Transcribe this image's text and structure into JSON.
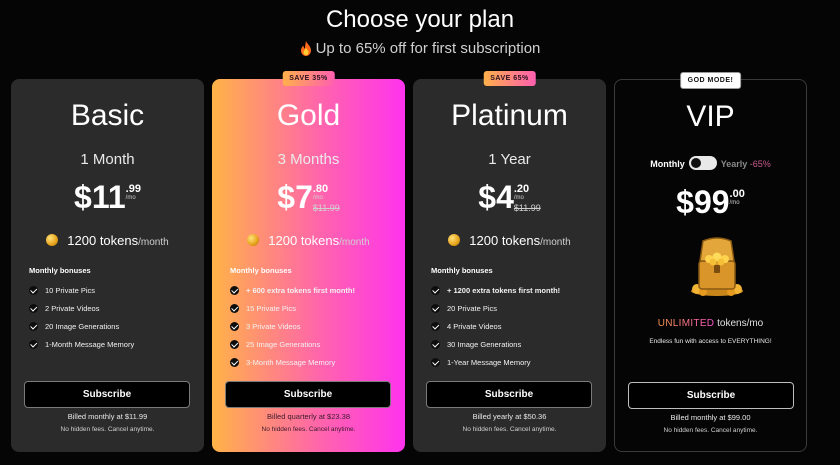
{
  "header": {
    "title": "Choose your plan",
    "subtitle": "Up to 65% off for first subscription"
  },
  "plans": {
    "basic": {
      "name": "Basic",
      "period": "1 Month",
      "price_main": "$11",
      "price_cents": ".99",
      "price_unit": "/mo",
      "tokens": "1200 tokens",
      "tokens_per": "/month",
      "bonus_title": "Monthly bonuses",
      "bonuses": [
        "10 Private Pics",
        "2 Private Videos",
        "20 Image Generations",
        "1-Month Message Memory"
      ],
      "subscribe_label": "Subscribe",
      "billed": "Billed monthly at $11.99",
      "no_fees": "No hidden fees. Cancel anytime."
    },
    "gold": {
      "badge": "SAVE 35%",
      "name": "Gold",
      "period": "3 Months",
      "price_main": "$7",
      "price_cents": ".80",
      "price_unit": "/mo",
      "old_price": "$11.99",
      "tokens": "1200 tokens",
      "tokens_per": "/month",
      "bonus_title": "Monthly bonuses",
      "bonuses": [
        "+ 600 extra tokens first month!",
        "15 Private Pics",
        "3 Private Videos",
        "25 Image Generations",
        "3-Month Message Memory"
      ],
      "subscribe_label": "Subscribe",
      "billed": "Billed quarterly at $23.38",
      "no_fees": "No hidden fees. Cancel anytime."
    },
    "platinum": {
      "badge": "SAVE 65%",
      "name": "Platinum",
      "period": "1 Year",
      "price_main": "$4",
      "price_cents": ".20",
      "price_unit": "/mo",
      "old_price": "$11.99",
      "tokens": "1200 tokens",
      "tokens_per": "/month",
      "bonus_title": "Monthly bonuses",
      "bonuses": [
        "+ 1200 extra tokens first month!",
        "20 Private Pics",
        "4 Private Videos",
        "30 Image Generations",
        "1-Year Message Memory"
      ],
      "subscribe_label": "Subscribe",
      "billed": "Billed yearly at $50.36",
      "no_fees": "No hidden fees. Cancel anytime."
    },
    "vip": {
      "badge": "GOD MODE!",
      "name": "VIP",
      "toggle_monthly": "Monthly",
      "toggle_yearly": "Yearly",
      "toggle_discount": "-65%",
      "price_main": "$99",
      "price_cents": ".00",
      "price_unit": "/mo",
      "unlimited": "UNLIMITED",
      "unlimited_rest": "tokens/mo",
      "endless": "Endless fun with access to EVERYTHING!",
      "subscribe_label": "Subscribe",
      "billed": "Billed monthly at $99.00",
      "no_fees": "No hidden fees. Cancel anytime."
    }
  },
  "colors": {
    "background": "#050505",
    "card": "#2b2b2b",
    "gold_gradient_start": "#ffb347",
    "gold_gradient_end": "#ff33ee",
    "accent_pink": "#ff55c8"
  },
  "icons": {
    "subtitle_icon": "flame-icon",
    "token_icon": "coin-icon",
    "bonus_icon": "check-circle-icon",
    "vip_image": "treasure-chest-icon"
  }
}
